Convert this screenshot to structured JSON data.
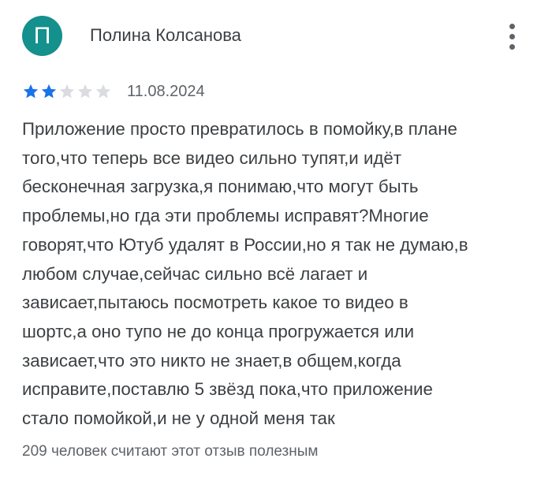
{
  "review": {
    "author": {
      "name": "Полина Колсанова",
      "initial": "П",
      "avatar_color": "#14908d"
    },
    "more_menu_icon": "more-vert-icon",
    "rating": 2,
    "max_rating": 5,
    "star_filled_color": "#1a73e8",
    "star_empty_color": "#dadce0",
    "date": "11.08.2024",
    "text_lines": [
      "Приложение просто превратилось в помойку,в плане",
      "того,что теперь все видео сильно тупят,и идёт",
      "бесконечная загрузка,я понимаю,что могут быть",
      "проблемы,но гда эти проблемы исправят?Многие",
      "говорят,что Ютуб удалят в России,но я так не думаю,в",
      "любом случае,сейчас сильно всё лагает и",
      "зависает,пытаюсь посмотреть какое то видео в",
      "шортс,а оно тупо не до конца прогружается или",
      "зависает,что это никто не знает,в общем,когда",
      "исправите,поставлю 5 звёзд пока,что приложение",
      "стало помойкой,и не у одной меня так"
    ],
    "helpful_text": "209 человек считают этот отзыв полезным"
  }
}
